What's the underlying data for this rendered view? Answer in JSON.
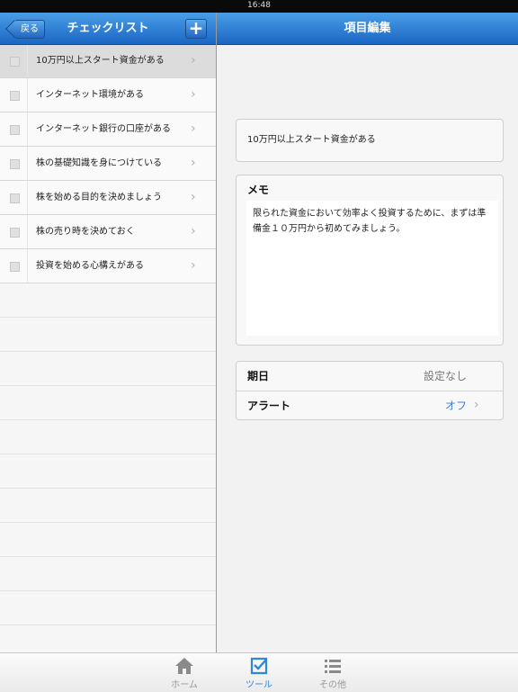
{
  "status": {
    "time": "16:48"
  },
  "left_nav": {
    "back_label": "戻る",
    "title": "チェックリスト",
    "add_label": "+"
  },
  "checklist": {
    "items": [
      {
        "label": "10万円以上スタート資金がある"
      },
      {
        "label": "インターネット環境がある"
      },
      {
        "label": "インターネット銀行の口座がある"
      },
      {
        "label": "株の基礎知識を身につけている"
      },
      {
        "label": "株を始める目的を決めましょう"
      },
      {
        "label": "株の売り時を決めておく"
      },
      {
        "label": "投資を始める心構えがある"
      }
    ],
    "selected_index": 0
  },
  "right_nav": {
    "title": "項目編集"
  },
  "editor": {
    "item_title": "10万円以上スタート資金がある",
    "memo_label": "メモ",
    "memo_text": "限られた資金において効率よく投資するために、まずは準備金１０万円から初めてみましょう。",
    "due_label": "期日",
    "due_value": "設定なし",
    "alert_label": "アラート",
    "alert_value": "オフ"
  },
  "tabbar": {
    "tabs": [
      {
        "label": "ホーム",
        "icon": "home-icon"
      },
      {
        "label": "ツール",
        "icon": "checkbox-icon"
      },
      {
        "label": "その他",
        "icon": "list-icon"
      }
    ],
    "active_index": 1
  },
  "colors": {
    "accent": "#2e86dd",
    "nav_bar": "#1a66c4",
    "alert_value": "#3d7fd6"
  }
}
